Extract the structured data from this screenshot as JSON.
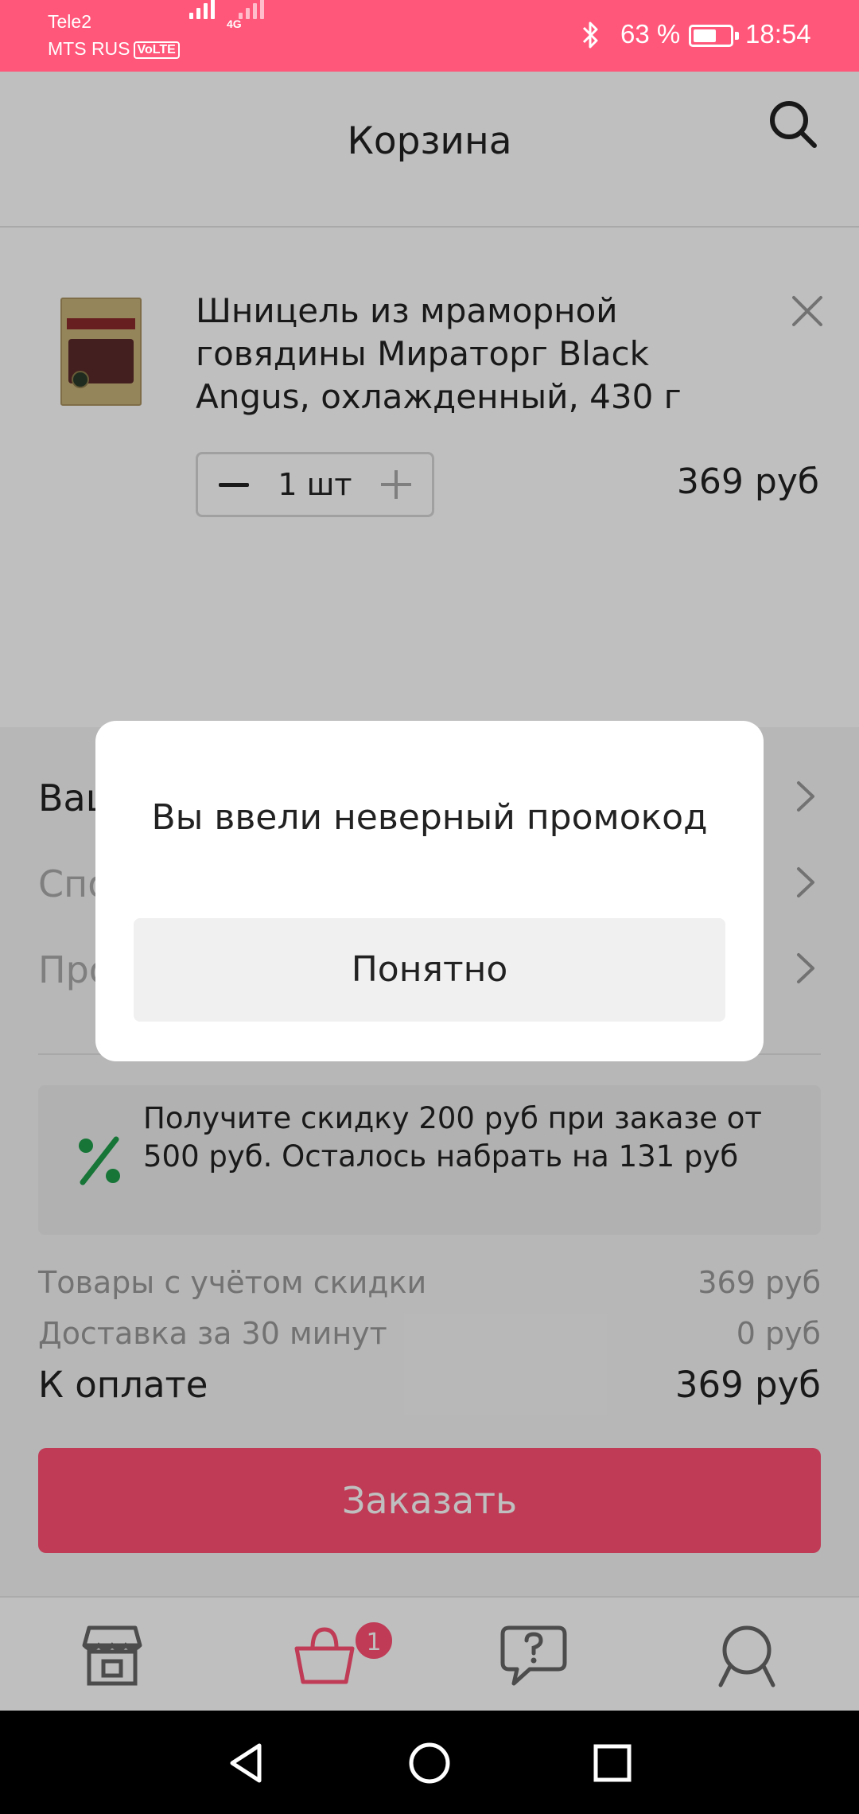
{
  "status_bar": {
    "carrier1": "Tele2",
    "carrier2": "MTS RUS",
    "volte": "VoLTE",
    "network": "4G",
    "battery_percent": "63 %",
    "battery_level": 0.63,
    "time": "18:54"
  },
  "header": {
    "title": "Корзина",
    "search_icon": "search-icon"
  },
  "cart_item": {
    "name": "Шницель из мраморной говядины Мираторг Black Angus, охлажденный, 430 г",
    "quantity": "1 шт",
    "price": "369 руб"
  },
  "options": [
    {
      "label": "Ваш"
    },
    {
      "label": "Спо"
    },
    {
      "label": "Про"
    }
  ],
  "promo_banner": {
    "text": "Получите скидку 200 руб при заказе от 500 руб. Осталось набрать на 131 руб",
    "icon_color": "#1e9d4a"
  },
  "summary": {
    "goods_label": "Товары с учётом скидки",
    "goods_value": "369 руб",
    "delivery_label": "Доставка за 30 минут",
    "delivery_value": "0 руб",
    "total_label": "К оплате",
    "total_value": "369 руб"
  },
  "order_button": "Заказать",
  "bottom_nav": {
    "cart_badge": "1",
    "items": [
      "store-icon",
      "cart-icon",
      "help-icon",
      "profile-icon"
    ]
  },
  "dialog": {
    "message": "Вы ввели неверный промокод",
    "button": "Понятно"
  },
  "colors": {
    "accent": "#ff4f73",
    "status_bar": "#ff577a"
  }
}
